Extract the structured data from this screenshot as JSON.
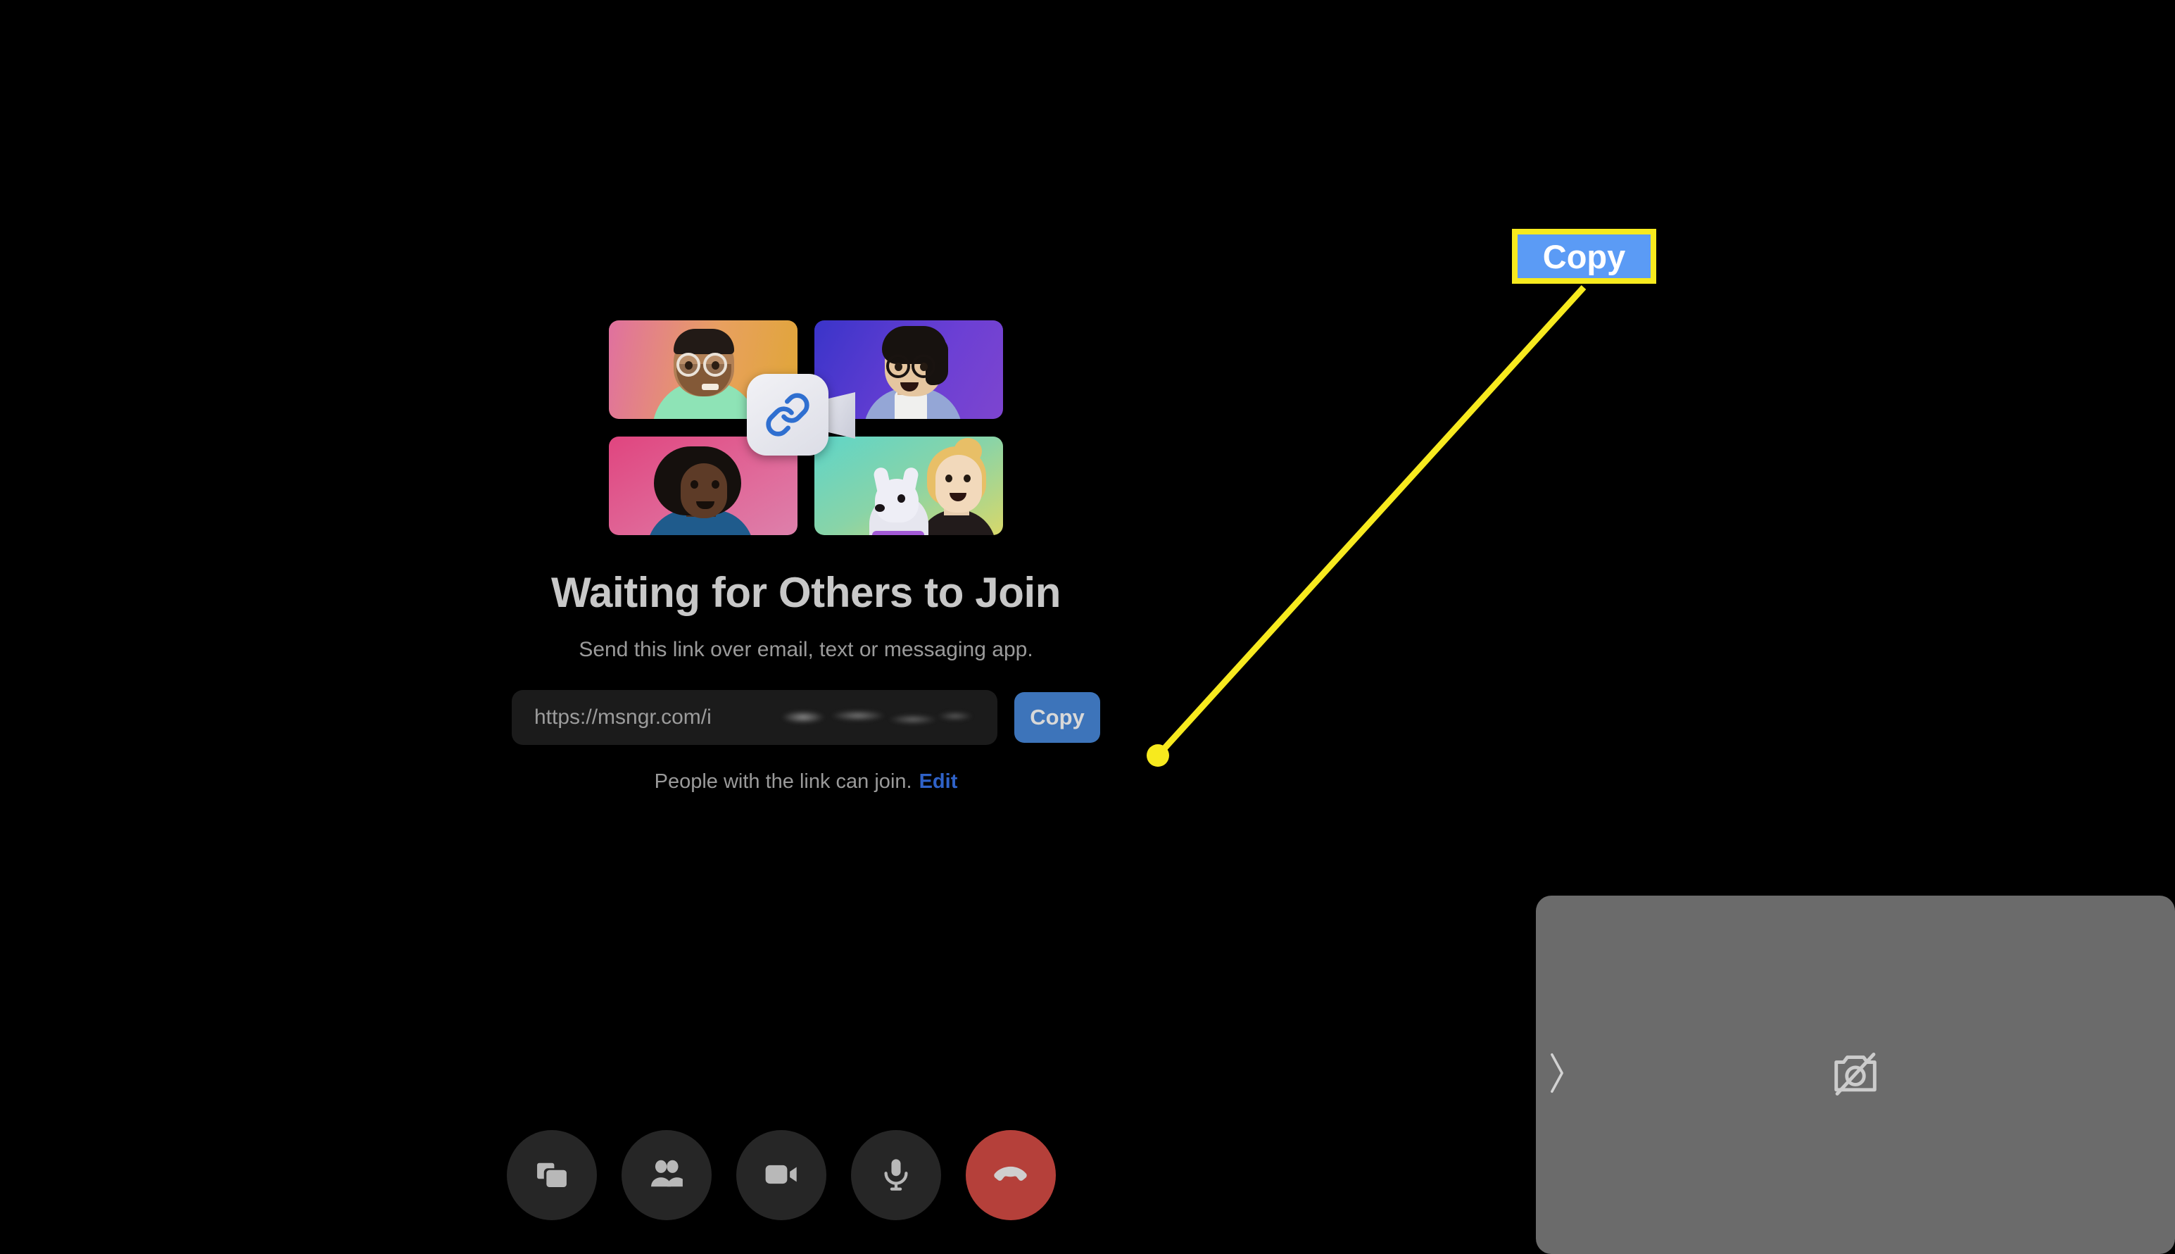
{
  "screen": {
    "background_color": "#000000"
  },
  "waiting_panel": {
    "headline": "Waiting for Others to Join",
    "subtext": "Send this link over email, text or messaging app.",
    "illustration": {
      "name": "video-call-grid-illustration",
      "center_icon": "link-icon",
      "tiles": [
        {
          "position": "top-left",
          "person": "person-with-glasses-and-beard",
          "gradient_from": "#e0709f",
          "gradient_to": "#e0a637"
        },
        {
          "position": "top-right",
          "person": "person-with-round-glasses",
          "gradient_from": "#3a34c9",
          "gradient_to": "#7d45cf"
        },
        {
          "position": "bottom-left",
          "person": "person-with-afro",
          "gradient_from": "#e0457f",
          "gradient_to": "#dd80ab"
        },
        {
          "position": "bottom-right",
          "person": "person-with-dog",
          "gradient_from": "#5fd5c8",
          "gradient_to": "#d8d86a"
        }
      ]
    },
    "link": {
      "value": "https://msngr.com/i",
      "placeholder": "https://msngr.com/i",
      "redacted": true
    },
    "copy_button_label": "Copy",
    "copy_button_color": "#3d74ba",
    "permission": {
      "text": "People with the link can join.",
      "edit_label": "Edit",
      "edit_color": "#2f62c8"
    }
  },
  "toolbar": {
    "buttons": [
      {
        "name": "share-screen-button",
        "icon": "screen-share-icon",
        "label": "Share screen",
        "variant": "default"
      },
      {
        "name": "participants-button",
        "icon": "people-icon",
        "label": "Participants",
        "variant": "default"
      },
      {
        "name": "camera-button",
        "icon": "video-camera-icon",
        "label": "Camera",
        "variant": "default"
      },
      {
        "name": "microphone-button",
        "icon": "microphone-icon",
        "label": "Microphone",
        "variant": "default"
      },
      {
        "name": "end-call-button",
        "icon": "phone-hangup-icon",
        "label": "End call",
        "variant": "danger"
      }
    ],
    "default_color": "#262626",
    "danger_color": "#b5403a"
  },
  "self_view": {
    "name": "self-view-panel",
    "background_color": "#6b6b6b",
    "status_icon": "camera-off-icon",
    "collapse_handle_icon": "chevron-right-icon"
  },
  "annotation": {
    "label": "Copy",
    "border_color": "#f7ea1e",
    "fill_color": "#5b9bf5",
    "text_color": "#ffffff",
    "line_color": "#f7ea1e",
    "target": "copy-button"
  }
}
